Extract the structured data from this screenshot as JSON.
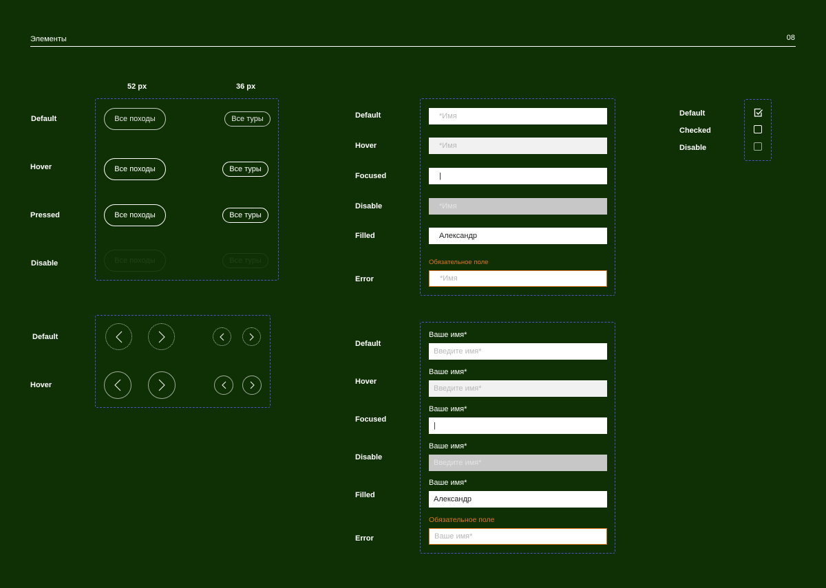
{
  "header": {
    "title": "Элементы",
    "page_number": "08"
  },
  "buttons": {
    "size_large": "52 px",
    "size_small": "36 px",
    "states": [
      "Default",
      "Hover",
      "Pressed",
      "Disable"
    ],
    "large_label": "Все походы",
    "small_label": "Все туры"
  },
  "arrows": {
    "states": [
      "Default",
      "Hover"
    ],
    "icons": [
      "chevron-left-icon",
      "chevron-right-icon"
    ]
  },
  "inputs": {
    "states": [
      "Default",
      "Hover",
      "Focused",
      "Disable",
      "Filled",
      "Error"
    ],
    "placeholder": "*Имя",
    "cursor": "|",
    "filled_value": "Александр",
    "error_text": "Обязательное поле"
  },
  "labeled_inputs": {
    "states": [
      "Default",
      "Hover",
      "Focused",
      "Disable",
      "Filled",
      "Error"
    ],
    "label": "Ваше имя*",
    "placeholder": "Введите имя*",
    "cursor": "|",
    "filled_value": "Александр",
    "error_text": "Обязательное поле",
    "error_placeholder": "Ваше имя*"
  },
  "checkboxes": {
    "states": [
      "Default",
      "Checked",
      "Disable"
    ],
    "icons": [
      "checkbox-checked-icon",
      "checkbox-empty-icon",
      "checkbox-empty-icon"
    ]
  },
  "colors": {
    "background": "#0e3004",
    "dash_border": "#4a56c8",
    "error": "#e2751b"
  }
}
